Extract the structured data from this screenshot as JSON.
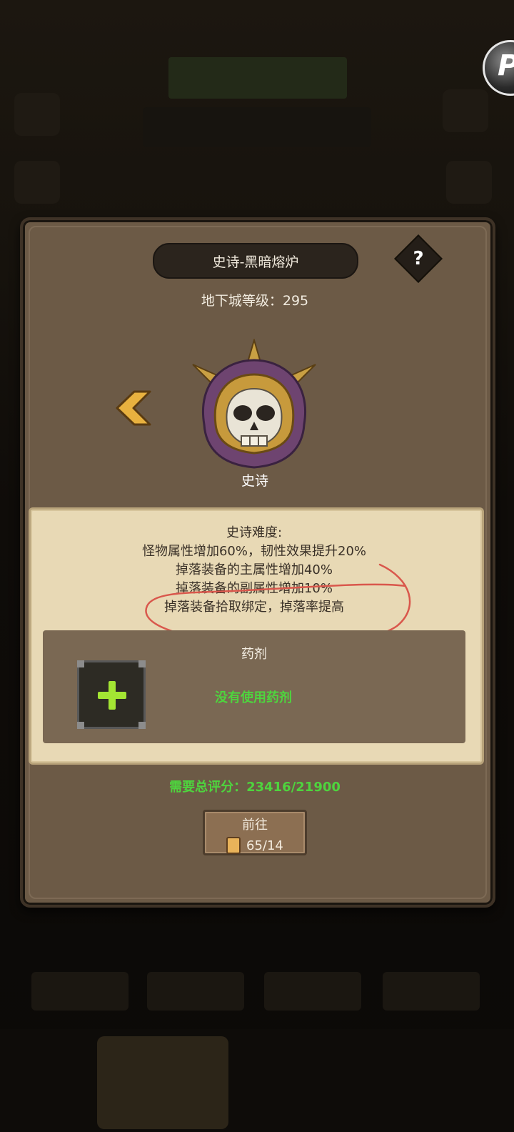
{
  "dialog": {
    "title": "史诗-黑暗熔炉",
    "help_label": "?",
    "dungeon_level_label": "地下城等级：",
    "dungeon_level_value": "295",
    "difficulty_name": "史诗",
    "info_lines": [
      "史诗难度:",
      "怪物属性增加60%，韧性效果提升20%",
      "掉落装备的主属性增加40%",
      "掉落装备的副属性增加10%",
      "掉落装备拾取绑定，掉落率提高"
    ],
    "potion_title": "药剂",
    "no_potion_text": "没有使用药剂",
    "score_label": "需要总评分：",
    "score_value": "23416/21900",
    "go_label": "前往",
    "go_cost": "65/14"
  },
  "icons": {
    "help": "question-mark-icon",
    "prev": "chevron-left-icon",
    "boss": "skull-helmet-icon",
    "add_potion": "plus-icon",
    "ticket": "scroll-icon"
  },
  "colors": {
    "dialog_bg": "#6c5a46",
    "panel_bg": "#e8d9b5",
    "green_text": "#4ed43e",
    "arrow": "#e8b13f",
    "annotation": "#d9574c"
  }
}
